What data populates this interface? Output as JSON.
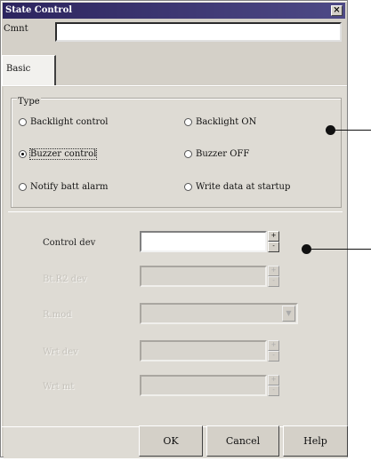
{
  "window": {
    "title": "State Control",
    "close_glyph": "×"
  },
  "comment": {
    "label": "Cmnt",
    "value": ""
  },
  "tabs": [
    {
      "label": "Basic",
      "selected": true
    }
  ],
  "type_group": {
    "legend": "Type",
    "options": [
      {
        "label": "Backlight control",
        "checked": false
      },
      {
        "label": "Backlight ON",
        "checked": false
      },
      {
        "label": "Buzzer control",
        "checked": true,
        "focused": true
      },
      {
        "label": "Buzzer OFF",
        "checked": false
      },
      {
        "label": "Notify batt alarm",
        "checked": false
      },
      {
        "label": "Write data at startup",
        "checked": false
      }
    ]
  },
  "fields": {
    "control_dev": {
      "label": "Control dev",
      "value": "",
      "enabled": true
    },
    "field2": {
      "label": "Bt.R2 dev",
      "enabled": false
    },
    "field3": {
      "label": "R.mod",
      "enabled": false
    },
    "field4": {
      "label": "Wrt dev",
      "enabled": false
    },
    "field5": {
      "label": "Wrt mt",
      "enabled": false
    }
  },
  "spin": {
    "up": "+",
    "down": "-"
  },
  "dropdown_glyph": "▼",
  "buttons": {
    "ok": "OK",
    "cancel": "Cancel",
    "help": "Help"
  },
  "colors": {
    "titlebar": "#2c245e",
    "face": "#d4d0c8",
    "panel": "#dedbd4"
  }
}
